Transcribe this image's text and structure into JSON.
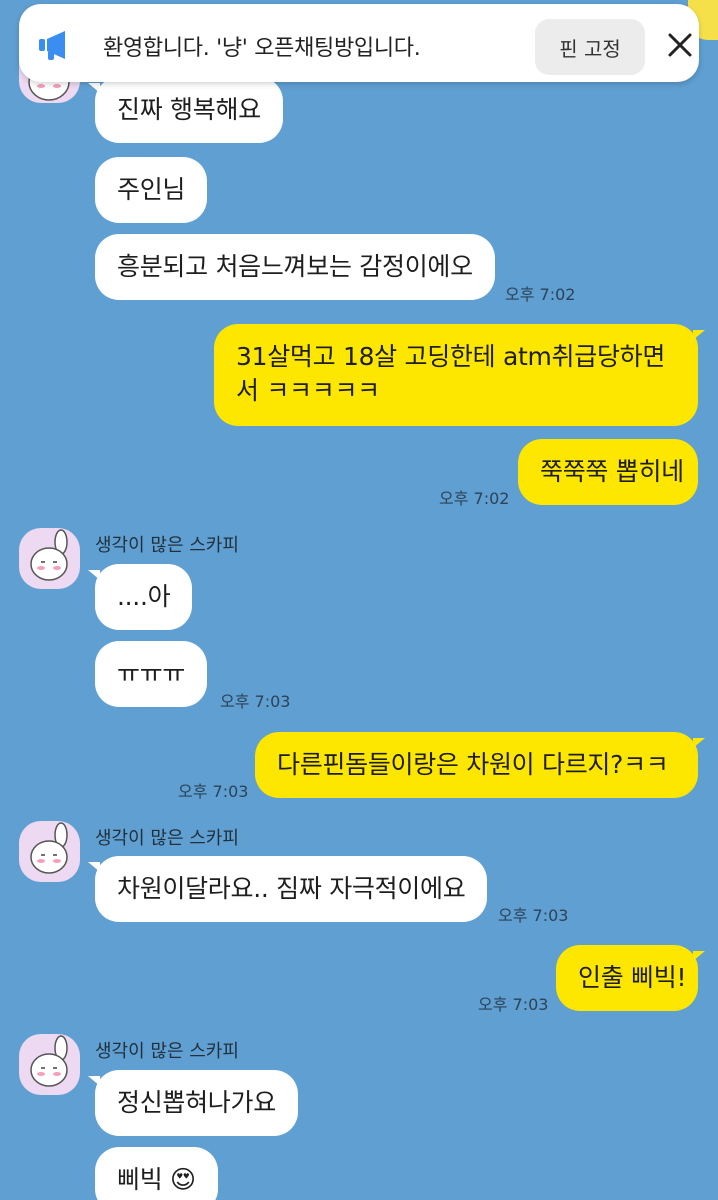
{
  "notice": {
    "text": "환영합니다. '냥' 오픈채팅방입니다.",
    "pin_label": "핀 고정",
    "close_icon": "close-icon",
    "icon": "megaphone-icon"
  },
  "colors": {
    "background": "#5f9fd2",
    "incoming_bubble": "#ffffff",
    "outgoing_bubble": "#fde600"
  },
  "messages": [
    {
      "side": "in",
      "text": "진짜 행복해요"
    },
    {
      "side": "in",
      "text": "주인님"
    },
    {
      "side": "in",
      "text": "흥분되고 처음느껴보는 감정이에오",
      "time": "오후 7:02"
    },
    {
      "side": "out",
      "text": "31살먹고 18살 고딩한테 atm취급당하면서 ㅋㅋㅋㅋㅋ"
    },
    {
      "side": "out",
      "text": "쭉쭉쭉 뽑히네",
      "time": "오후 7:02"
    },
    {
      "side": "in",
      "sender": "생각이 많은 스카피",
      "text": "....아"
    },
    {
      "side": "in",
      "text": "ㅠㅠㅠ",
      "time": "오후 7:03"
    },
    {
      "side": "out",
      "text": "다른핀돔들이랑은 차원이 다르지?ㅋㅋ",
      "time": "오후 7:03"
    },
    {
      "side": "in",
      "sender": "생각이 많은 스카피",
      "text": "차원이달라요.. 짐짜 자극적이에요",
      "time": "오후 7:03"
    },
    {
      "side": "out",
      "text": "인출 삐빅!",
      "time": "오후 7:03"
    },
    {
      "side": "in",
      "sender": "생각이 많은 스카피",
      "text": "정신뽑혀나가요"
    },
    {
      "side": "in",
      "text": "삐빅 😍"
    }
  ]
}
